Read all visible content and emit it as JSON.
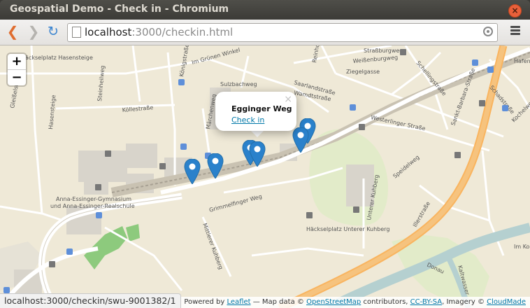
{
  "window": {
    "title": "Geospatial Demo - Check in - Chromium",
    "close_label": "×"
  },
  "toolbar": {
    "back_label": "❮",
    "forward_label": "❯",
    "reload_label": "↻",
    "url_host": "localhost",
    "url_rest": ":3000/checkin.html"
  },
  "map": {
    "zoom_in_label": "+",
    "zoom_out_label": "−",
    "street_labels": [
      "Häckselplatz Hasensteige",
      "Im Grünen Winkel",
      "Saarlandstraße",
      "Wamdtstraße",
      "Königstraße",
      "Sulzbachweg",
      "Köllestraße",
      "Märchenweg",
      "Hasensteige",
      "Grimmelfinger Weg",
      "Mittlerer Kuhberg",
      "Westerlinger Straße",
      "Speidelweg",
      "Unterer Kuhberg",
      "Häckselplatz Unterer Kuhberg",
      "Illerstraße",
      "Sankt-Barbara-Straße",
      "Ziegelgasse",
      "Weißenburgweg",
      "Straßburgweg",
      "Schellingstraße",
      "Donau",
      "Kaltwasser",
      "Anna-Essinger-Gymnasium",
      "und Anna-Essinger-Realschule",
      "Steinheilweg",
      "Gleißelstetten",
      "Schadstraße",
      "Hafenbad",
      "Im Kornfeld",
      "Reinhold",
      "Kochelweg"
    ],
    "popup": {
      "title": "Egginger Weg",
      "link": "Check in",
      "close": "×"
    },
    "attribution": {
      "prefix": "Powered by",
      "leaflet": "Leaflet",
      "map_data": "— Map data ©",
      "osm": "OpenStreetMap",
      "contributors": "contributors,",
      "license": "CC-BY-SA",
      "imagery": ", Imagery ©",
      "cloudmade": "CloudMade"
    },
    "accent_color": "#2a81cb"
  },
  "status": {
    "url": "localhost:3000/checkin/swu-9001382/1"
  }
}
